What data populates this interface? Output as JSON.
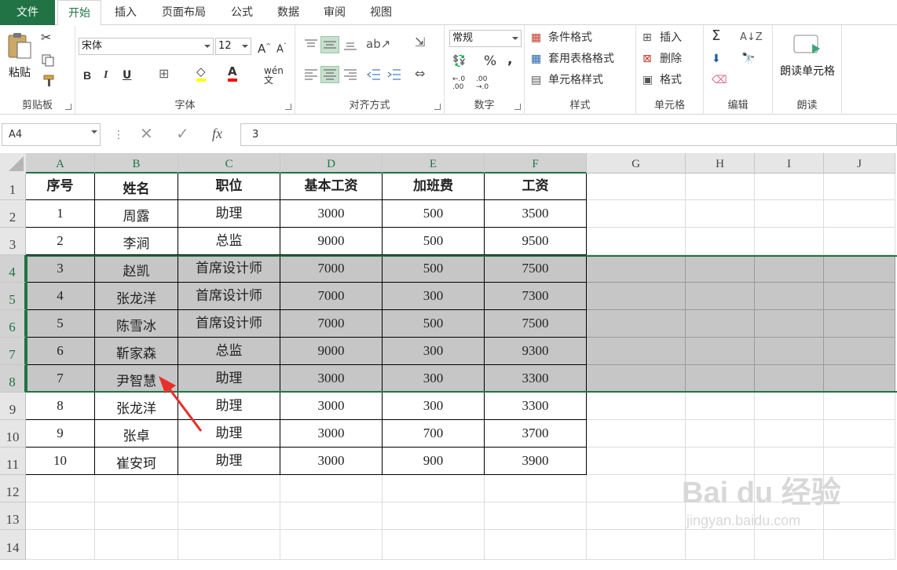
{
  "ribbon_tabs": [
    "文件",
    "开始",
    "插入",
    "页面布局",
    "公式",
    "数据",
    "审阅",
    "视图"
  ],
  "clipboard": {
    "paste": "粘贴",
    "label": "剪贴板"
  },
  "font": {
    "name": "宋体",
    "size": "12",
    "label": "字体",
    "bold": "B",
    "italic": "I",
    "underline": "U",
    "wen": "wén\n文"
  },
  "align": {
    "label": "对齐方式"
  },
  "number": {
    "format": "常规",
    "percent": "%",
    "comma": ",",
    "label": "数字"
  },
  "styles": {
    "conditional": "条件格式",
    "table": "套用表格格式",
    "cell": "单元格样式",
    "label": "样式"
  },
  "cells": {
    "insert": "插入",
    "delete": "删除",
    "format": "格式",
    "label": "单元格"
  },
  "editing": {
    "label": "编辑"
  },
  "read": {
    "button": "朗读单元格",
    "label": "朗读"
  },
  "formula_bar": {
    "name_box": "A4",
    "fx": "fx",
    "value": "3"
  },
  "columns": [
    "A",
    "B",
    "C",
    "D",
    "E",
    "F",
    "G",
    "H",
    "I",
    "J"
  ],
  "rows": [
    "1",
    "2",
    "3",
    "4",
    "5",
    "6",
    "7",
    "8",
    "9",
    "10",
    "11",
    "12",
    "13",
    "14"
  ],
  "table": {
    "headers": [
      "序号",
      "姓名",
      "职位",
      "基本工资",
      "加班费",
      "工资"
    ],
    "data": [
      [
        "1",
        "周露",
        "助理",
        "3000",
        "500",
        "3500"
      ],
      [
        "2",
        "李涧",
        "总监",
        "9000",
        "500",
        "9500"
      ],
      [
        "3",
        "赵凯",
        "首席设计师",
        "7000",
        "500",
        "7500"
      ],
      [
        "4",
        "张龙洋",
        "首席设计师",
        "7000",
        "300",
        "7300"
      ],
      [
        "5",
        "陈雪冰",
        "首席设计师",
        "7000",
        "500",
        "7500"
      ],
      [
        "6",
        "靳家森",
        "总监",
        "9000",
        "300",
        "9300"
      ],
      [
        "7",
        "尹智慧",
        "助理",
        "3000",
        "300",
        "3300"
      ],
      [
        "8",
        "张龙洋",
        "助理",
        "3000",
        "300",
        "3300"
      ],
      [
        "9",
        "张卓",
        "助理",
        "3000",
        "700",
        "3700"
      ],
      [
        "10",
        "崔安珂",
        "助理",
        "3000",
        "900",
        "3900"
      ]
    ]
  },
  "watermark": {
    "brand": "Bai du 经验",
    "url": "jingyan.baidu.com"
  },
  "colors": {
    "accent": "#217346",
    "selection": "#c6c6c6",
    "arrow": "#e8302b"
  }
}
